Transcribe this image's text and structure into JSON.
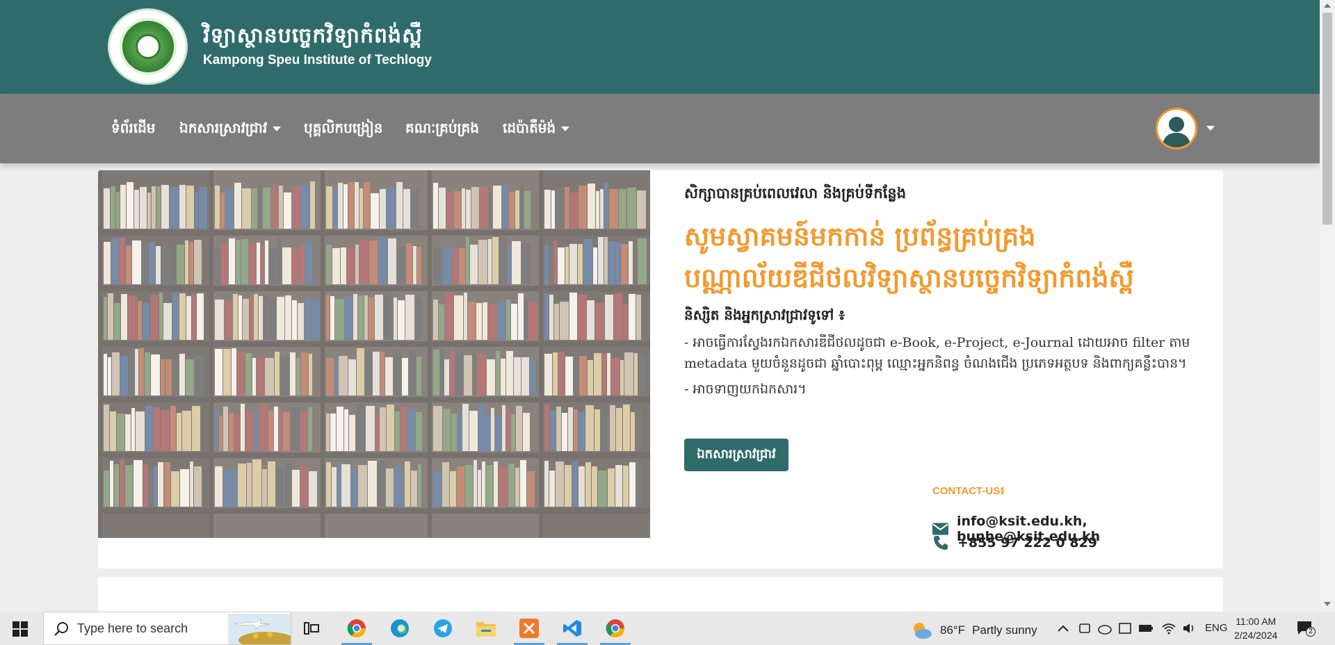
{
  "header": {
    "title_kh": "វិទ្យាស្ថានបច្ចេកវិទ្យាកំពង់ស្ពឺ",
    "title_en": "Kampong Speu Institute of Techlogy"
  },
  "nav": {
    "items": [
      {
        "label": "ទំព័រដើម",
        "dropdown": false
      },
      {
        "label": "ឯកសារស្រាវជ្រាវ",
        "dropdown": true
      },
      {
        "label": "បុគ្គលិកបង្រៀន",
        "dropdown": false
      },
      {
        "label": "គណៈគ្រប់គ្រង",
        "dropdown": false
      },
      {
        "label": "ដេប៉ាតឺម៉ង់",
        "dropdown": true
      }
    ]
  },
  "hero": {
    "tagline": "សិក្សាបានគ្រប់ពេលវេលា និងគ្រប់ទីកន្លែង",
    "welcome": "សូមស្វាគមន៍មកកាន់  ប្រព័ន្ធគ្រប់គ្រងបណ្ណាល័យឌីជីថលវិទ្យាស្ថានបច្ចេកវិទ្យាកំពង់ស្ពឺ",
    "sub_heading": "និស្សិត និងអ្នកស្រាវជ្រាវទូទៅ ៖",
    "desc1": "- អាចធ្វើការស្វែងរកឯកសារឌីជីថលដូចជា e-Book, e-Project, e-Journal ដោយអាច filter តាម metadata មួយចំនួនដូចជា ឆ្នាំបោះពុម្ព ឈ្មោះអ្នកនិពន្ធ ចំណងជើង ប្រភេទអត្ថបទ និងពាក្យគន្លឹះបាន។",
    "desc2": "- អាចទាញយកឯកសារ។",
    "button_label": "ឯកសារស្រាវជ្រាវ"
  },
  "contact": {
    "title": "CONTACT-US៖",
    "email": "info@ksit.edu.kh, bunhe@ksit.edu.kh",
    "phone": "+855 97 222 0 829"
  },
  "taskbar": {
    "search_placeholder": "Type here to search",
    "weather_temp": "86°F",
    "weather_text": "Partly sunny",
    "language": "ENG",
    "time": "11:00 AM",
    "date": "2/24/2024",
    "notification_count": "2"
  },
  "colors": {
    "brand_teal": "#2f6b6b",
    "nav_gray": "#7d7d7d",
    "accent_orange": "#f29a2e"
  }
}
